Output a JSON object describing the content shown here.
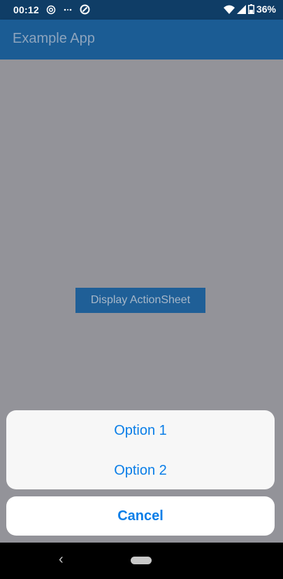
{
  "status_bar": {
    "time": "00:12",
    "battery": "36%",
    "icons": [
      "nfc-icon",
      "more-dots-icon",
      "sync-icon",
      "wifi-icon",
      "signal-icon",
      "battery-icon"
    ]
  },
  "app_bar": {
    "title": "Example App"
  },
  "main": {
    "display_button_label": "Display ActionSheet"
  },
  "action_sheet": {
    "options": [
      "Option 1",
      "Option 2"
    ],
    "cancel_label": "Cancel"
  },
  "nav_bar": {
    "back_icon": "‹"
  },
  "colors": {
    "status_bar_bg": "#0f3d66",
    "app_bar_bg": "#1b5c94",
    "scrim": "#939399",
    "action_text": "#0a7ee8"
  }
}
